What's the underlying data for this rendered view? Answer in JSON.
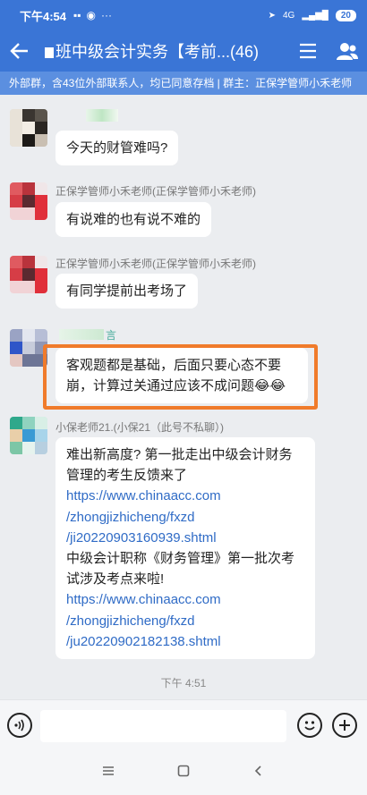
{
  "status": {
    "time": "下午4:54",
    "signal": "4G",
    "battery": "20"
  },
  "header": {
    "title": "班中级会计实务【考前...(46)"
  },
  "notice": "外部群，含43位外部联系人，均已同意存档 | 群主：正保学管师小禾老师",
  "messages": [
    {
      "sender": "",
      "text": "今天的财管难吗?"
    },
    {
      "sender": "正保学管师小禾老师(正保学管师小禾老师)",
      "text": "有说难的也有说不难的"
    },
    {
      "sender": "正保学管师小禾老师(正保学管师小禾老师)",
      "text": "有同学提前出考场了"
    },
    {
      "sender": "言",
      "line1": "客观题都是基础，后面只要心态不要",
      "line2": "崩，计算过关通过应该不成问题",
      "emoji": "😂😂"
    },
    {
      "sender": "小保老师21.(小保21（此号不私聊）)",
      "lines": [
        "难出新高度? 第一批走出中级会计财务",
        "管理的考生反馈来了",
        "https://www.chinaacc.com",
        "/zhongjizhicheng/fxzd",
        "/ji20220903160939.shtml",
        "中级会计职称《财务管理》第一批次考",
        "试涉及考点来啦!",
        "https://www.chinaacc.com",
        "/zhongjizhicheng/fxzd",
        "/ju20220902182138.shtml"
      ]
    }
  ],
  "timestamp": "下午 4:51",
  "colors": {
    "accent": "#3a75d6",
    "link": "#2f6bc6",
    "highlight": "#f07b2b"
  }
}
